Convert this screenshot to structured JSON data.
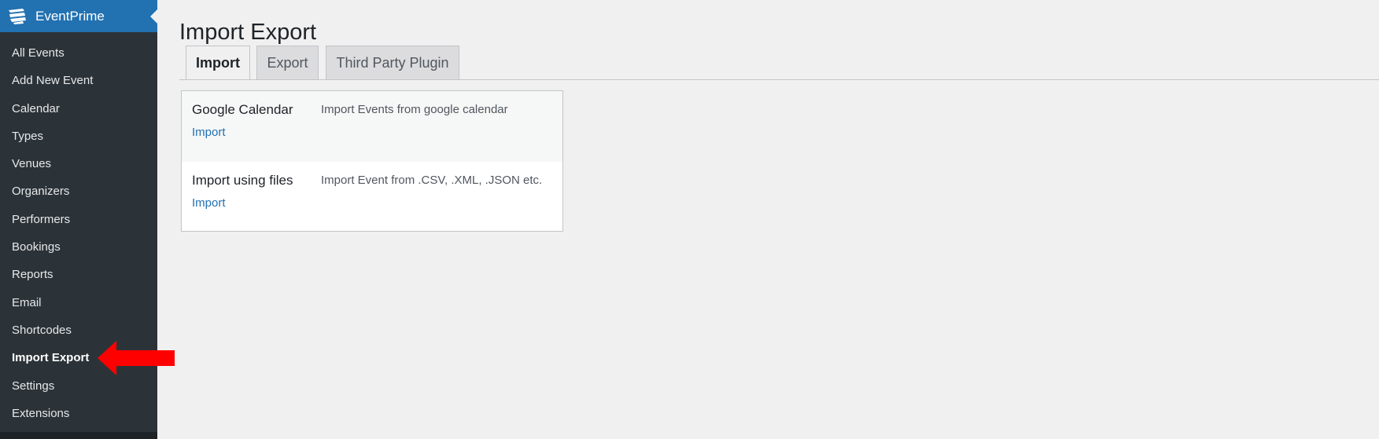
{
  "sidebar": {
    "brand": "EventPrime",
    "items": [
      {
        "label": "All Events"
      },
      {
        "label": "Add New Event"
      },
      {
        "label": "Calendar"
      },
      {
        "label": "Types"
      },
      {
        "label": "Venues"
      },
      {
        "label": "Organizers"
      },
      {
        "label": "Performers"
      },
      {
        "label": "Bookings"
      },
      {
        "label": "Reports"
      },
      {
        "label": "Email"
      },
      {
        "label": "Shortcodes"
      },
      {
        "label": "Import Export"
      },
      {
        "label": "Settings"
      },
      {
        "label": "Extensions"
      }
    ],
    "active_item": "Import Export",
    "colors": {
      "header": "#2271b1",
      "background": "#2c3338"
    }
  },
  "annotation": {
    "arrow_color": "#ff0000"
  },
  "page": {
    "title": "Import Export",
    "tabs": [
      {
        "label": "Import"
      },
      {
        "label": "Export"
      },
      {
        "label": "Third Party Plugin"
      }
    ],
    "active_tab": "Import",
    "rows": [
      {
        "name": "Google Calendar",
        "description": "Import Events from google calendar",
        "action": "Import"
      },
      {
        "name": "Import using files",
        "description": "Import Event from .CSV, .XML, .JSON etc.",
        "action": "Import"
      }
    ]
  }
}
